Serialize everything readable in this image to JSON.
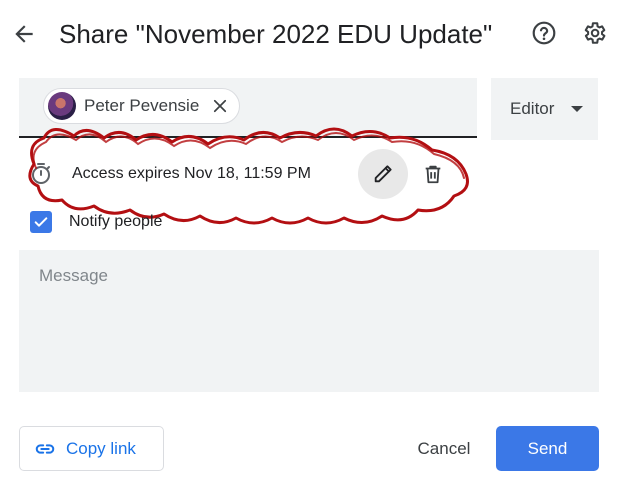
{
  "dialog": {
    "title": "Share \"November 2022 EDU Update\""
  },
  "recipients": [
    {
      "name": "Peter Pevensie",
      "avatar_icon": "user-avatar"
    }
  ],
  "role": {
    "selected": "Editor"
  },
  "access": {
    "expiry_text": "Access expires Nov 18, 11:59 PM"
  },
  "notify": {
    "label": "Notify people",
    "checked": true
  },
  "message": {
    "placeholder": "Message",
    "value": ""
  },
  "actions": {
    "copy_link": "Copy link",
    "cancel": "Cancel",
    "send": "Send"
  },
  "colors": {
    "accent": "#3b78e7",
    "link": "#1a73e8",
    "annotation": "#b30f12",
    "field_bg": "#f1f3f4"
  },
  "icons": [
    "back-arrow-icon",
    "help-icon",
    "settings-icon",
    "close-icon",
    "dropdown-arrow-icon",
    "timer-icon",
    "pencil-icon",
    "trash-icon",
    "check-icon",
    "link-icon"
  ]
}
